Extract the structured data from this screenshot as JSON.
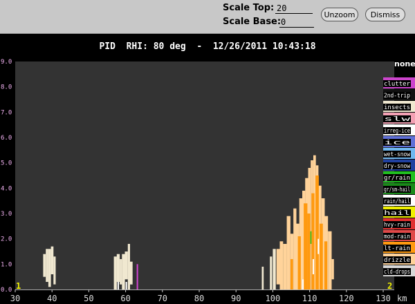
{
  "toolbar": {
    "scale_top_label": "Scale Top:",
    "scale_top_value": "20",
    "scale_base_label": "Scale Base:",
    "scale_base_value": "0",
    "unzoom_label": "Unzoom",
    "dismiss_label": "Dismiss"
  },
  "plot": {
    "title": "PID  RHI: 80 deg  -  12/26/2011 10:43:18",
    "corner_left": "1",
    "corner_right": "2",
    "background": "#333333"
  },
  "chart_data": {
    "type": "heatmap",
    "x": {
      "ticks": [
        "30",
        "40",
        "50",
        "60",
        "70",
        "80",
        "90",
        "100",
        "110",
        "120",
        "130"
      ],
      "unit": "km",
      "range": [
        30,
        133
      ]
    },
    "y": {
      "ticks": [
        "0.0",
        "1.0",
        "2.0",
        "3.0",
        "4.0",
        "5.0",
        "6.0",
        "7.0",
        "8.0",
        "9.0"
      ],
      "range": [
        0,
        9
      ]
    },
    "legend": {
      "header": "none",
      "items": [
        {
          "label": "clutter",
          "color": "#cc44cc"
        },
        {
          "label": "2nd-trip",
          "color": "#111111"
        },
        {
          "label": "insects",
          "color": "#f0e8d0"
        },
        {
          "label": "slw",
          "color": "#f4a0b4"
        },
        {
          "label": "irreg-ice",
          "color": "#ffffff"
        },
        {
          "label": "ice",
          "color": "#6070d8"
        },
        {
          "label": "wet-snow",
          "color": "#70b8f0"
        },
        {
          "label": "dry-snow",
          "color": "#2040a0"
        },
        {
          "label": "gr/rain",
          "color": "#20c020"
        },
        {
          "label": "gr/sm-hail",
          "color": "#1a8a1a"
        },
        {
          "label": "rain/hail",
          "color": "#ffffff"
        },
        {
          "label": "hail",
          "color": "#f0f000"
        },
        {
          "label": "hvy-rain",
          "color": "#e03030"
        },
        {
          "label": "mod-rain",
          "color": "#e04848"
        },
        {
          "label": "lt-rain",
          "color": "#ff9a10"
        },
        {
          "label": "drizzle",
          "color": "#ffd39a"
        },
        {
          "label": "cld-drops",
          "color": "#d8d8d8"
        }
      ]
    },
    "cells": [
      {
        "x0": 37.6,
        "x1": 38.3,
        "y0": 0.5,
        "y1": 1.4,
        "class": "insects"
      },
      {
        "x0": 38.3,
        "x1": 39.0,
        "y0": 0.3,
        "y1": 1.6,
        "class": "insects"
      },
      {
        "x0": 39.0,
        "x1": 39.7,
        "y0": 0.1,
        "y1": 1.6,
        "class": "insects"
      },
      {
        "x0": 39.7,
        "x1": 40.4,
        "y0": 0.6,
        "y1": 1.7,
        "class": "insects"
      },
      {
        "x0": 40.4,
        "x1": 41.0,
        "y0": 0.2,
        "y1": 1.3,
        "class": "insects"
      },
      {
        "x0": 56.8,
        "x1": 57.6,
        "y0": 0.0,
        "y1": 1.3,
        "class": "insects"
      },
      {
        "x0": 57.6,
        "x1": 58.4,
        "y0": 0.3,
        "y1": 1.4,
        "class": "insects"
      },
      {
        "x0": 58.4,
        "x1": 59.0,
        "y0": 0.2,
        "y1": 1.2,
        "class": "insects"
      },
      {
        "x0": 59.0,
        "x1": 59.8,
        "y0": 0.0,
        "y1": 1.4,
        "class": "insects"
      },
      {
        "x0": 59.8,
        "x1": 60.6,
        "y0": 0.4,
        "y1": 1.5,
        "class": "insects"
      },
      {
        "x0": 60.6,
        "x1": 61.2,
        "y0": 0.0,
        "y1": 1.8,
        "class": "insects"
      },
      {
        "x0": 61.2,
        "x1": 61.9,
        "y0": 0.2,
        "y1": 1.1,
        "class": "insects"
      },
      {
        "x0": 57.8,
        "x1": 58.2,
        "y0": 0.0,
        "y1": 0.3,
        "class": "irreg-ice"
      },
      {
        "x0": 60.0,
        "x1": 60.4,
        "y0": 0.0,
        "y1": 0.3,
        "class": "irreg-ice"
      },
      {
        "x0": 63.0,
        "x1": 63.4,
        "y0": 0.0,
        "y1": 1.0,
        "class": "clutter"
      },
      {
        "x0": 97.0,
        "x1": 97.5,
        "y0": 0.0,
        "y1": 0.9,
        "class": "insects"
      },
      {
        "x0": 99.2,
        "x1": 99.8,
        "y0": 0.0,
        "y1": 1.3,
        "class": "insects"
      },
      {
        "x0": 100.0,
        "x1": 100.8,
        "y0": 0.0,
        "y1": 1.6,
        "class": "insects"
      },
      {
        "x0": 101.0,
        "x1": 101.9,
        "y0": 0.2,
        "y1": 1.6,
        "class": "drizzle"
      },
      {
        "x0": 101.9,
        "x1": 102.8,
        "y0": 0.0,
        "y1": 1.9,
        "class": "drizzle"
      },
      {
        "x0": 102.8,
        "x1": 103.8,
        "y0": 0.0,
        "y1": 1.8,
        "class": "drizzle"
      },
      {
        "x0": 103.8,
        "x1": 104.8,
        "y0": 0.0,
        "y1": 2.9,
        "class": "drizzle"
      },
      {
        "x0": 104.8,
        "x1": 105.6,
        "y0": 0.0,
        "y1": 2.2,
        "class": "drizzle"
      },
      {
        "x0": 105.6,
        "x1": 106.4,
        "y0": 0.0,
        "y1": 3.2,
        "class": "drizzle"
      },
      {
        "x0": 106.4,
        "x1": 107.2,
        "y0": 0.0,
        "y1": 2.6,
        "class": "drizzle"
      },
      {
        "x0": 107.2,
        "x1": 108.0,
        "y0": 0.0,
        "y1": 3.6,
        "class": "drizzle"
      },
      {
        "x0": 108.0,
        "x1": 108.8,
        "y0": 0.0,
        "y1": 3.9,
        "class": "drizzle"
      },
      {
        "x0": 108.8,
        "x1": 109.6,
        "y0": 0.0,
        "y1": 4.4,
        "class": "drizzle"
      },
      {
        "x0": 109.6,
        "x1": 110.3,
        "y0": 0.0,
        "y1": 4.8,
        "class": "drizzle"
      },
      {
        "x0": 110.3,
        "x1": 111.0,
        "y0": 0.0,
        "y1": 5.1,
        "class": "drizzle"
      },
      {
        "x0": 111.0,
        "x1": 111.7,
        "y0": 0.0,
        "y1": 5.3,
        "class": "drizzle"
      },
      {
        "x0": 111.7,
        "x1": 112.4,
        "y0": 0.0,
        "y1": 4.9,
        "class": "drizzle"
      },
      {
        "x0": 112.4,
        "x1": 113.2,
        "y0": 0.0,
        "y1": 4.1,
        "class": "drizzle"
      },
      {
        "x0": 113.2,
        "x1": 114.1,
        "y0": 0.0,
        "y1": 3.6,
        "class": "drizzle"
      },
      {
        "x0": 114.1,
        "x1": 115.0,
        "y0": 0.0,
        "y1": 2.9,
        "class": "drizzle"
      },
      {
        "x0": 115.0,
        "x1": 116.0,
        "y0": 0.0,
        "y1": 2.3,
        "class": "drizzle"
      },
      {
        "x0": 116.0,
        "x1": 116.6,
        "y0": 0.4,
        "y1": 1.2,
        "class": "drizzle"
      },
      {
        "x0": 104.8,
        "x1": 105.5,
        "y0": 0.0,
        "y1": 1.2,
        "class": "lt-rain"
      },
      {
        "x0": 106.8,
        "x1": 107.6,
        "y0": 0.0,
        "y1": 2.1,
        "class": "lt-rain"
      },
      {
        "x0": 108.4,
        "x1": 109.4,
        "y0": 0.0,
        "y1": 3.4,
        "class": "lt-rain"
      },
      {
        "x0": 109.4,
        "x1": 110.2,
        "y0": 0.0,
        "y1": 3.0,
        "class": "lt-rain"
      },
      {
        "x0": 110.5,
        "x1": 111.3,
        "y0": 0.0,
        "y1": 3.8,
        "class": "lt-rain"
      },
      {
        "x0": 111.6,
        "x1": 112.5,
        "y0": 0.0,
        "y1": 4.5,
        "class": "lt-rain"
      },
      {
        "x0": 112.7,
        "x1": 113.6,
        "y0": 0.0,
        "y1": 2.6,
        "class": "lt-rain"
      },
      {
        "x0": 114.0,
        "x1": 114.8,
        "y0": 0.0,
        "y1": 1.9,
        "class": "lt-rain"
      },
      {
        "x0": 110.8,
        "x1": 111.2,
        "y0": 0.6,
        "y1": 1.2,
        "class": "irreg-ice"
      },
      {
        "x0": 112.2,
        "x1": 112.6,
        "y0": 1.4,
        "y1": 2.0,
        "class": "irreg-ice"
      },
      {
        "x0": 108.0,
        "x1": 108.4,
        "y0": 0.0,
        "y1": 0.4,
        "class": "irreg-ice"
      },
      {
        "x0": 110.2,
        "x1": 110.5,
        "y0": 1.8,
        "y1": 2.3,
        "class": "gr/rain"
      }
    ]
  }
}
